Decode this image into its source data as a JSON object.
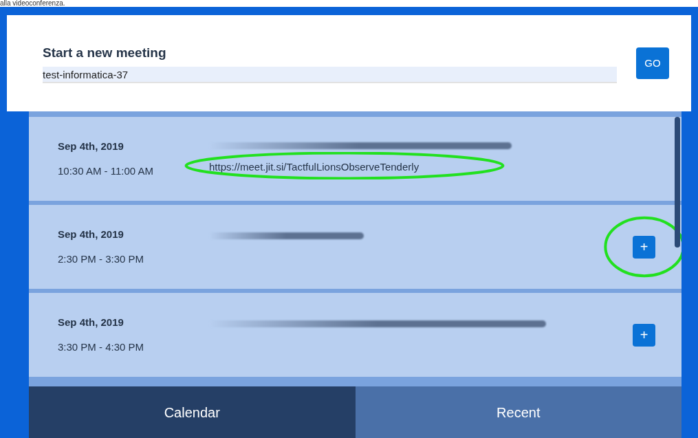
{
  "caption": "alla videoconferenza.",
  "new_meeting": {
    "title": "Start a new meeting",
    "value": "test-informatica-37",
    "button": "GO"
  },
  "meetings": [
    {
      "kind": "link",
      "date": "Sep 4th, 2019",
      "time": "10:30 AM - 11:00 AM",
      "url": "https://meet.jit.si/TactfulLionsObserveTenderly",
      "highlighted": true
    },
    {
      "kind": "add",
      "date": "Sep 4th, 2019",
      "time": "2:30 PM - 3:30 PM",
      "button": "+",
      "highlighted": true
    },
    {
      "kind": "add",
      "date": "Sep 4th, 2019",
      "time": "3:30 PM - 4:30 PM",
      "button": "+",
      "highlighted": false
    }
  ],
  "tabs": [
    {
      "label": "Calendar",
      "selected": true
    },
    {
      "label": "Recent",
      "selected": false
    }
  ]
}
